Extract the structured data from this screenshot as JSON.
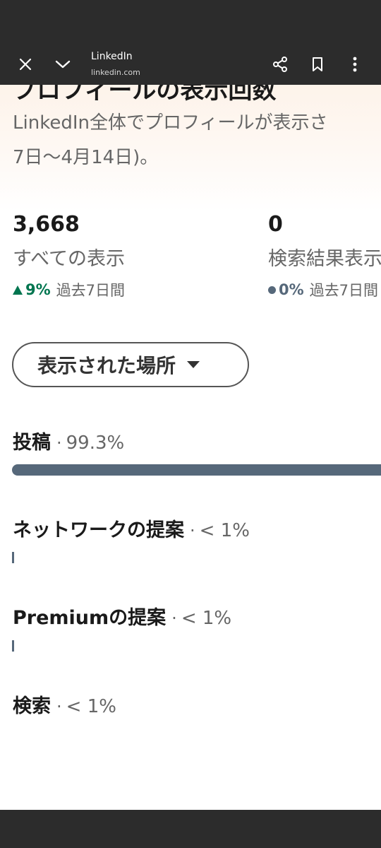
{
  "browser": {
    "site_name": "LinkedIn",
    "site_url": "linkedin.com",
    "icons": [
      "close-icon",
      "chevron-down-icon",
      "share-icon",
      "bookmark-icon",
      "more-vert-icon"
    ]
  },
  "page": {
    "title": "プロフィールの表示回数",
    "desc_line1": "LinkedIn全体でプロフィールが表示さ",
    "desc_line2": "7日〜4月14日)。"
  },
  "stats": [
    {
      "value": "3,668",
      "label": "すべての表示",
      "trend_pct": "9%",
      "trend_period": "過去7日間",
      "trend": "up",
      "trend_color": "#01754f"
    },
    {
      "value": "0",
      "label": "検索結果表示",
      "trend_pct": "0%",
      "trend_period": "過去7日間",
      "trend": "neutral",
      "trend_color": "#56687a"
    }
  ],
  "filter": {
    "label": "表示された場所"
  },
  "breakdown": [
    {
      "label": "投稿",
      "separator": "·",
      "pct": "99.3%",
      "fraction": 0.993
    },
    {
      "label": "ネットワークの提案",
      "separator": "·",
      "pct": "< 1%",
      "fraction": 0.005
    },
    {
      "label": "Premiumの提案",
      "separator": "·",
      "pct": "< 1%",
      "fraction": 0.005
    },
    {
      "label": "検索",
      "separator": "·",
      "pct": "< 1%",
      "fraction": 0.0
    }
  ],
  "colors": {
    "bar": "#56687a",
    "chrome": "#2c2c2c",
    "positive": "#01754f"
  }
}
